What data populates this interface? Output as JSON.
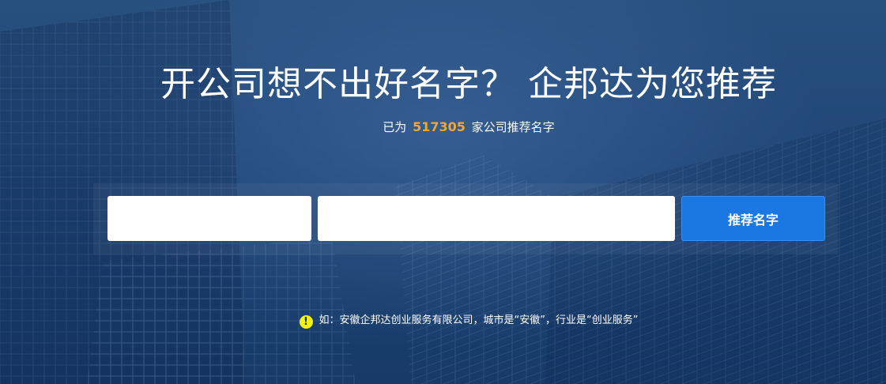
{
  "hero": {
    "title": "开公司想不出好名字？ 企邦达为您推荐",
    "subtitle_prefix": "已为",
    "company_count": "517305",
    "subtitle_suffix": "家公司推荐名字"
  },
  "form": {
    "city_value": "",
    "city_placeholder": "",
    "industry_value": "",
    "industry_placeholder": "",
    "submit_label": "推荐名字"
  },
  "hint": {
    "icon": "exclamation-icon",
    "text": "如：安徽企邦达创业服务有限公司，城市是“安徽”，行业是“创业服务”"
  },
  "colors": {
    "background": "#1d3f6e",
    "accent_count": "#f7a531",
    "button": "#1b78e2",
    "hint_icon": "#f6f20a"
  }
}
